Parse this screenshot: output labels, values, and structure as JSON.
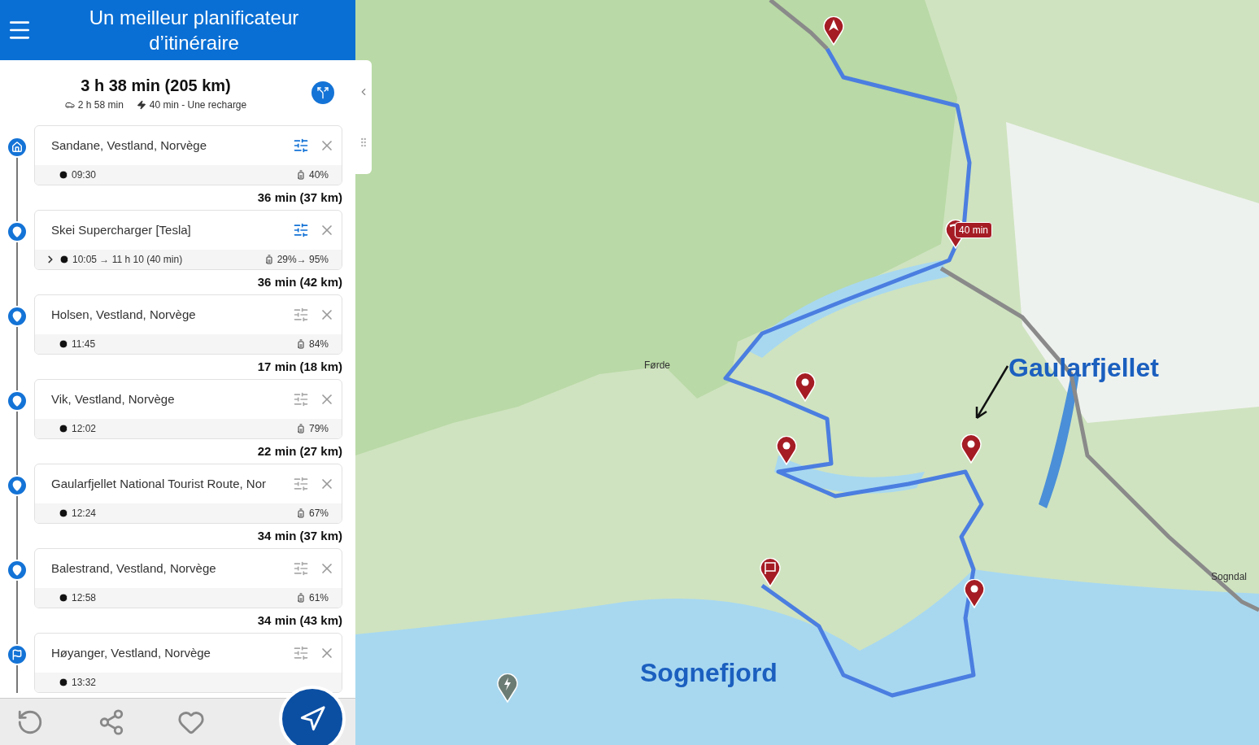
{
  "header": {
    "title": "Un meilleur planificateur d’itinéraire"
  },
  "summary": {
    "total": "3 h 38 min (205 km)",
    "drive": "2 h 58 min",
    "charge": "40 min - Une recharge"
  },
  "stops": [
    {
      "kind": "home",
      "name": "Sandane, Vestland, Norvège",
      "time": "09:30",
      "battery": "40%",
      "customized": true,
      "expandable": false
    },
    {
      "kind": "pin",
      "name": "Skei Supercharger [Tesla]",
      "time": "10:05 → 11 h 10 (40 min)",
      "battery": "29%→ 95%",
      "customized": true,
      "expandable": true
    },
    {
      "kind": "pin",
      "name": "Holsen, Vestland, Norvège",
      "time": "11:45",
      "battery": "84%",
      "customized": false,
      "expandable": false
    },
    {
      "kind": "pin",
      "name": "Vik, Vestland, Norvège",
      "time": "12:02",
      "battery": "79%",
      "customized": false,
      "expandable": false
    },
    {
      "kind": "pin",
      "name": "Gaularfjellet National Tourist Route, Nor",
      "time": "12:24",
      "battery": "67%",
      "customized": false,
      "expandable": false
    },
    {
      "kind": "pin",
      "name": "Balestrand, Vestland, Norvège",
      "time": "12:58",
      "battery": "61%",
      "customized": false,
      "expandable": false
    },
    {
      "kind": "finish",
      "name": "Høyanger, Vestland, Norvège",
      "time": "13:32",
      "customized": false,
      "expandable": false
    }
  ],
  "legs": [
    "36 min (37 km)",
    "36 min (42 km)",
    "17 min (18 km)",
    "22 min (27 km)",
    "34 min (37 km)",
    "34 min (43 km)"
  ],
  "map": {
    "charge_badge": "40 min",
    "labels": [
      {
        "kind": "town",
        "text": "Førde"
      },
      {
        "kind": "town",
        "text": "Sogndal"
      },
      {
        "kind": "annotation",
        "text": "Gaularfjellet"
      },
      {
        "kind": "annotation",
        "text": "Sognefjord"
      }
    ],
    "pins": [
      {
        "kind": "start"
      },
      {
        "kind": "charger"
      },
      {
        "kind": "stop"
      },
      {
        "kind": "stop"
      },
      {
        "kind": "stop"
      },
      {
        "kind": "stop"
      },
      {
        "kind": "finish"
      },
      {
        "kind": "station"
      }
    ]
  }
}
